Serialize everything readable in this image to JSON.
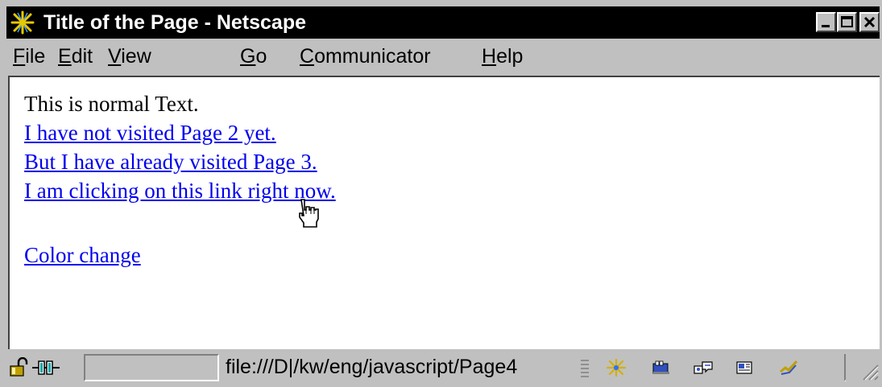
{
  "window": {
    "title": "Title of the Page - Netscape",
    "controls": [
      "minimize",
      "maximize",
      "close"
    ]
  },
  "menu": {
    "items": [
      {
        "accel": "F",
        "rest": "ile"
      },
      {
        "accel": "E",
        "rest": "dit"
      },
      {
        "accel": "V",
        "rest": "iew"
      },
      {
        "accel": "G",
        "rest": "o"
      },
      {
        "accel": "C",
        "rest": "ommunicator"
      },
      {
        "accel": "H",
        "rest": "elp"
      }
    ]
  },
  "content": {
    "normal_text": "This is normal Text.",
    "links": [
      "I have not visited Page 2 yet.",
      "But I have already visited Page 3.",
      "I am clicking on this link right now."
    ],
    "color_change_link": "Color change",
    "colors": {
      "link": "#0000ee",
      "text": "#000000",
      "background": "#ffffff"
    }
  },
  "statusbar": {
    "url": "file:///D|/kw/eng/javascript/Page4",
    "icons": [
      "lock-icon",
      "connection-icon",
      "navigator-icon",
      "mailbox-icon",
      "discussions-icon",
      "composer-icon",
      "component-bar-icon"
    ]
  },
  "cursor": "hand-pointer"
}
